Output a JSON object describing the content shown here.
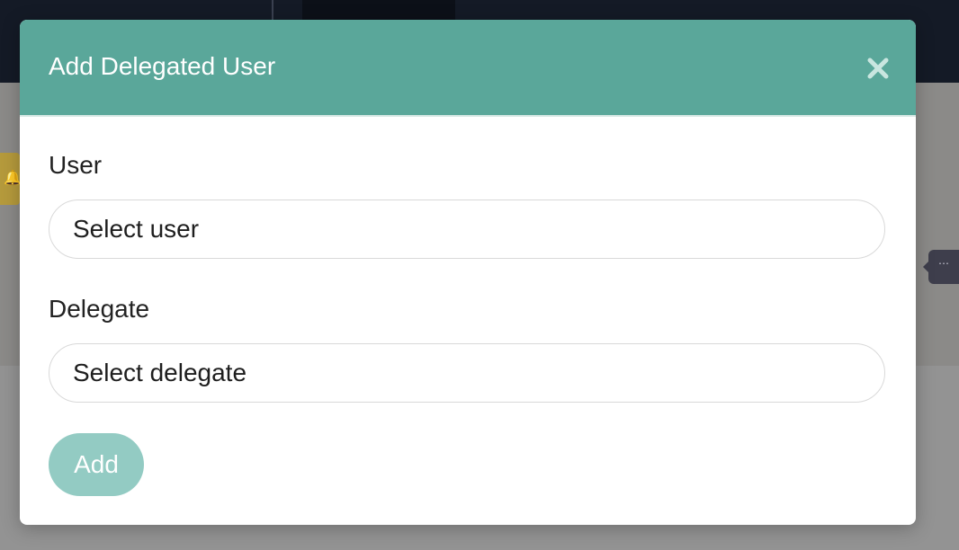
{
  "modal": {
    "title": "Add Delegated User",
    "close_icon": "close-icon",
    "user_label": "User",
    "user_value": "Select user",
    "delegate_label": "Delegate",
    "delegate_value": "Select delegate",
    "add_label": "Add"
  },
  "colors": {
    "header": "#5aa79a",
    "add_button": "#93cbc3",
    "topbar": "#141a26"
  }
}
